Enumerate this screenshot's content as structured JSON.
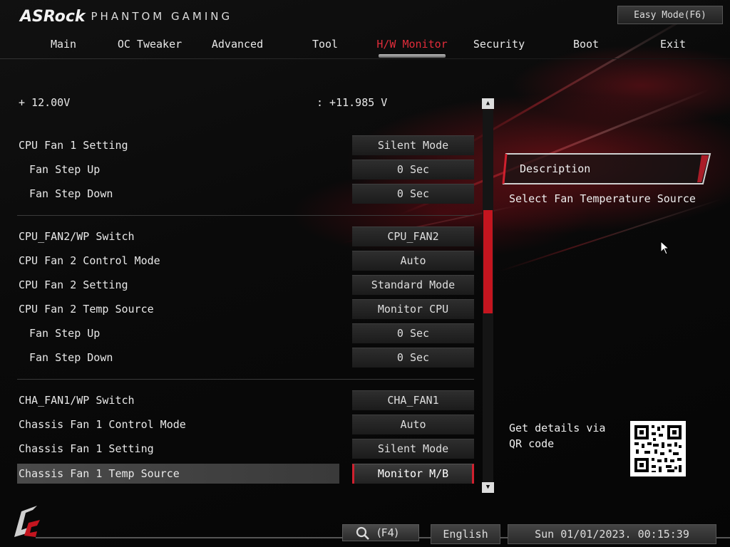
{
  "header": {
    "brand": "ASRock",
    "brand_sub": "PHANTOM GAMING",
    "easy_mode": "Easy Mode(F6)"
  },
  "nav": {
    "tabs": [
      {
        "label": "Main"
      },
      {
        "label": "OC Tweaker"
      },
      {
        "label": "Advanced"
      },
      {
        "label": "Tool"
      },
      {
        "label": "H/W Monitor",
        "active": true
      },
      {
        "label": "Security"
      },
      {
        "label": "Boot"
      },
      {
        "label": "Exit"
      }
    ]
  },
  "voltage": {
    "label": "+ 12.00V",
    "value": ": +11.985 V"
  },
  "settings": [
    {
      "label": "CPU Fan 1 Setting",
      "value": "Silent Mode"
    },
    {
      "label": "Fan Step Up",
      "value": "0 Sec"
    },
    {
      "label": "Fan Step Down",
      "value": "0 Sec"
    },
    {
      "label": "CPU_FAN2/WP Switch",
      "value": "CPU_FAN2"
    },
    {
      "label": "CPU Fan 2 Control Mode",
      "value": "Auto"
    },
    {
      "label": "CPU Fan 2 Setting",
      "value": "Standard Mode"
    },
    {
      "label": "CPU Fan 2 Temp Source",
      "value": "Monitor CPU"
    },
    {
      "label": "Fan Step Up",
      "value": "0 Sec"
    },
    {
      "label": "Fan Step Down",
      "value": "0 Sec"
    },
    {
      "label": "CHA_FAN1/WP Switch",
      "value": "CHA_FAN1"
    },
    {
      "label": "Chassis Fan 1 Control Mode",
      "value": "Auto"
    },
    {
      "label": "Chassis Fan 1 Setting",
      "value": "Silent Mode"
    },
    {
      "label": "Chassis Fan 1 Temp Source",
      "value": "Monitor M/B",
      "selected": true
    }
  ],
  "description": {
    "title": "Description",
    "text": "Select Fan Temperature Source",
    "qr_text": "Get details via QR code"
  },
  "footer": {
    "search_key": "(F4)",
    "language": "English",
    "datetime": "Sun 01/01/2023. 00:15:39"
  },
  "colors": {
    "accent": "#d0202e",
    "background": "#070707"
  }
}
